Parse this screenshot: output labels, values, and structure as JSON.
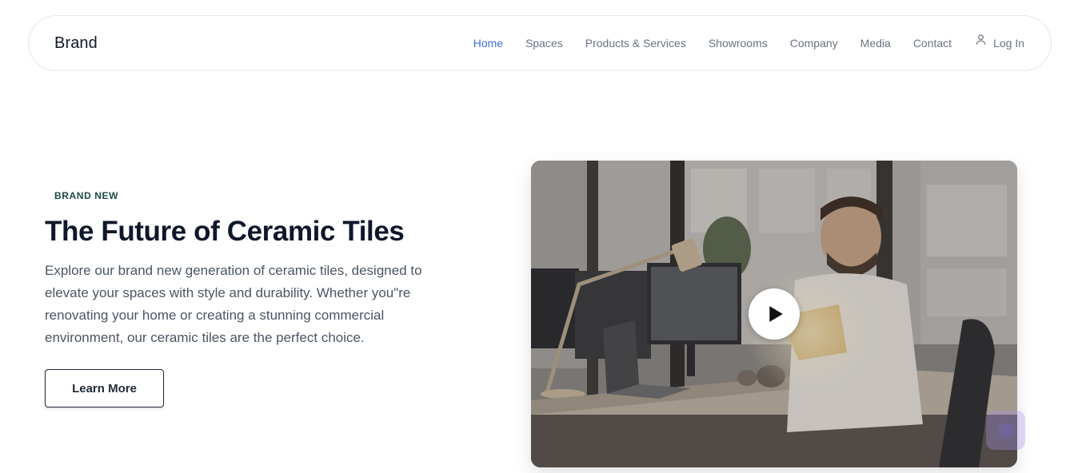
{
  "nav": {
    "brand": "Brand",
    "links": [
      "Home",
      "Spaces",
      "Products & Services",
      "Showrooms",
      "Company",
      "Media",
      "Contact"
    ],
    "active": "Home",
    "login_label": "Log In",
    "login_icon": "user-icon",
    "active_color": "#3b6fd1"
  },
  "hero": {
    "eyebrow": "BRAND NEW",
    "title": "The Future of Ceramic Tiles",
    "description": "Explore our brand new generation of ceramic tiles, designed to elevate your spaces with style and durability. Whether you\"re renovating your home or creating a stunning commercial environment, our ceramic tiles are the perfect choice.",
    "cta_label": "Learn More"
  },
  "video": {
    "play_icon": "play-icon"
  },
  "widget": {
    "icon": "chat-icon"
  }
}
